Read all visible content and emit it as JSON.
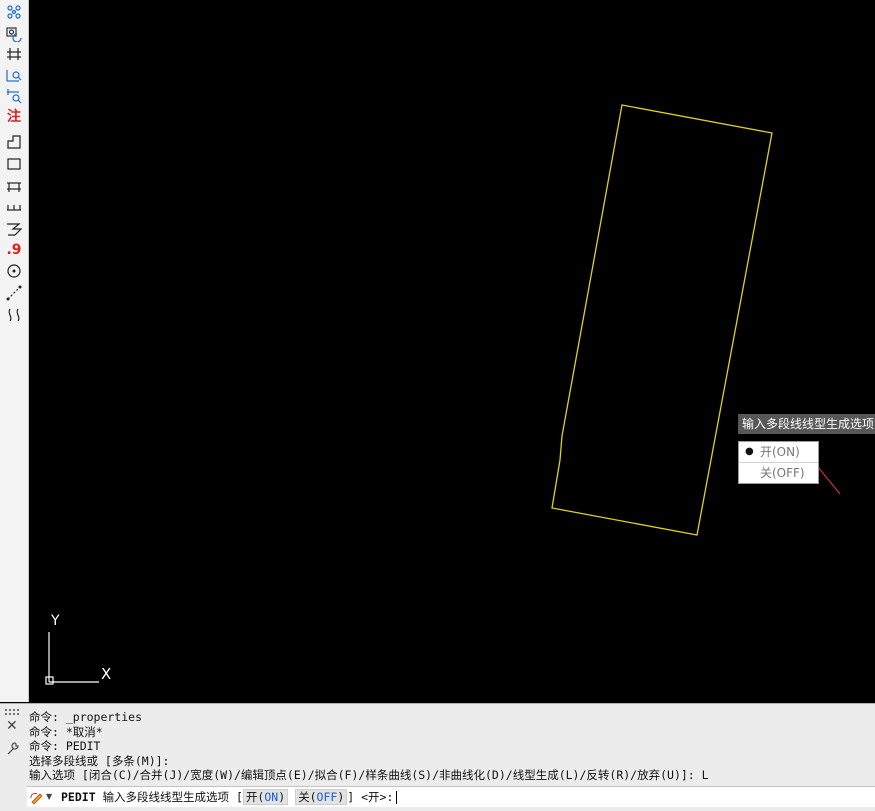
{
  "toolbar": {
    "tools": [
      {
        "name": "fit-points-icon",
        "color": "#1a6bd0"
      },
      {
        "name": "camera-rotate-icon",
        "color": "#1a6bd0"
      },
      {
        "name": "dimension-icon",
        "color": "#222222"
      },
      {
        "name": "xy-coordinate-icon",
        "color": "#1a6bd0"
      },
      {
        "name": "dimension-search-icon",
        "color": "#1a6bd0"
      },
      {
        "name": "annotation-text-icon",
        "label": "注",
        "color": "#e01f1f"
      },
      {
        "name": "step-shape-icon",
        "color": "#222222"
      },
      {
        "name": "rectangle-icon",
        "color": "#222222"
      },
      {
        "name": "beam-icon",
        "color": "#222222"
      },
      {
        "name": "ruler-icon",
        "color": "#222222"
      },
      {
        "name": "stair-icon",
        "color": "#222222"
      },
      {
        "name": "elevation-value-icon",
        "label": ".9",
        "color": "#e01f1f"
      },
      {
        "name": "target-circle-icon",
        "color": "#222222"
      },
      {
        "name": "diagonal-dimension-icon",
        "color": "#222222"
      },
      {
        "name": "break-line-icon",
        "color": "#222222"
      }
    ]
  },
  "canvas": {
    "background": "#000000",
    "shape_color": "#e0d020",
    "axis_color": "#ffffff",
    "ucs": {
      "y_label": "Y",
      "x_label": "X"
    }
  },
  "prompt": {
    "title": "输入多段线线型生成选项",
    "options": [
      {
        "label": "开(ON)",
        "selected": true
      },
      {
        "label": "关(OFF)",
        "selected": false
      }
    ]
  },
  "command": {
    "history": [
      "命令: _properties",
      "命令: *取消*",
      "命令: PEDIT",
      "选择多段线或 [多条(M)]:",
      "输入选项 [闭合(C)/合并(J)/宽度(W)/编辑顶点(E)/拟合(F)/样条曲线(S)/非曲线化(D)/线型生成(L)/反转(R)/放弃(U)]: L"
    ],
    "current_command": "PEDIT",
    "current_prompt": "输入多段线线型生成选项 [",
    "kw1_prefix": "开(",
    "kw1_key": "ON",
    "kw1_suffix": ")",
    "kw2_prefix": "关(",
    "kw2_key": "OFF",
    "kw2_suffix": ")",
    "prompt_end": "] <开>:"
  }
}
